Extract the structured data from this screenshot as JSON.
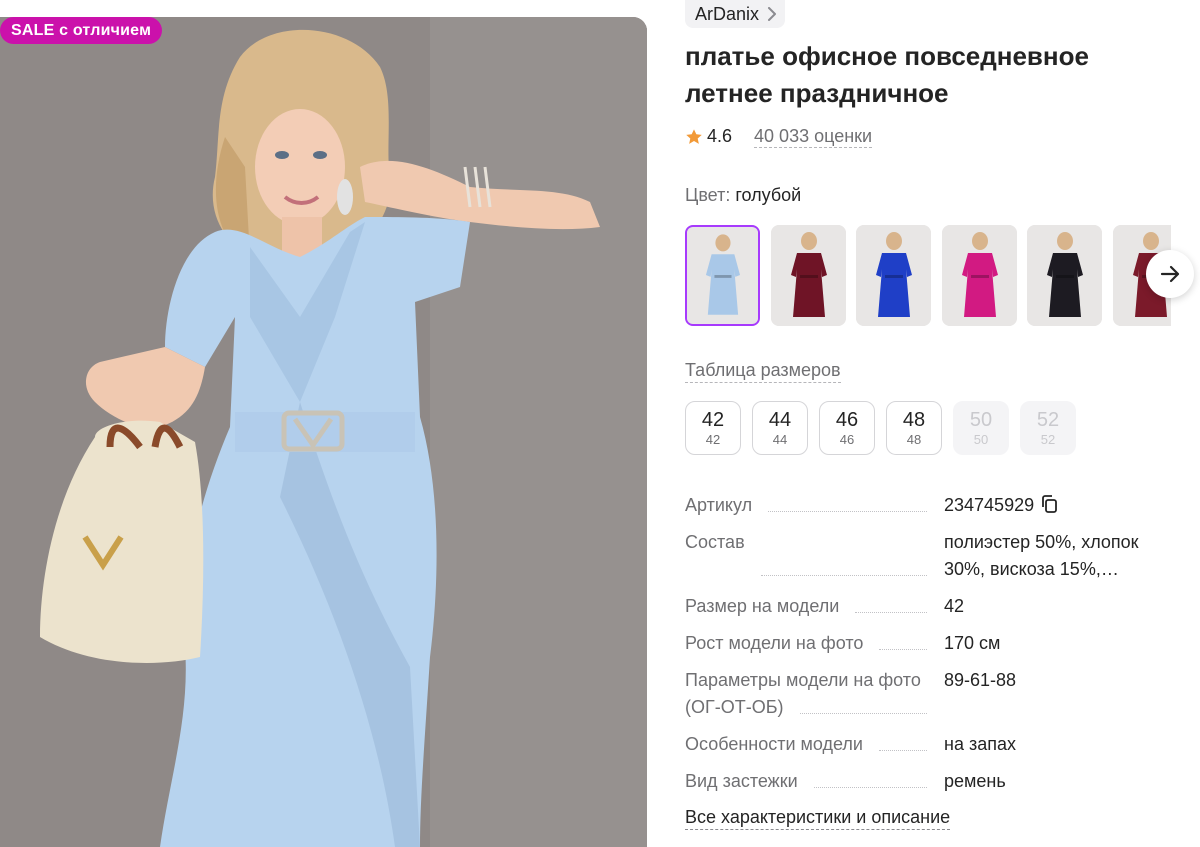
{
  "badge": {
    "sale_label": "SALE с отличием"
  },
  "product": {
    "brand": "ArDanix",
    "title": "платье офисное повседневное летнее праздничное",
    "rating": "4.6",
    "reviews": "40 033 оценки",
    "color_label": "Цвет:",
    "color_value": "голубой"
  },
  "swatches": [
    {
      "name": "light-blue",
      "color": "#a9c8e8",
      "selected": true
    },
    {
      "name": "burgundy",
      "color": "#6f1426"
    },
    {
      "name": "royal-blue",
      "color": "#1f3fc7"
    },
    {
      "name": "fuchsia",
      "color": "#d21a82"
    },
    {
      "name": "black-floral",
      "color": "#1d1b22"
    },
    {
      "name": "wine",
      "color": "#7b1a2a"
    }
  ],
  "size_table_label": "Таблица размеров",
  "sizes": [
    {
      "ru": "42",
      "intl": "42",
      "available": true
    },
    {
      "ru": "44",
      "intl": "44",
      "available": true
    },
    {
      "ru": "46",
      "intl": "46",
      "available": true
    },
    {
      "ru": "48",
      "intl": "48",
      "available": true
    },
    {
      "ru": "50",
      "intl": "50",
      "available": false
    },
    {
      "ru": "52",
      "intl": "52",
      "available": false
    }
  ],
  "specs": [
    {
      "key": "Артикул",
      "value": "234745929",
      "copy": true
    },
    {
      "key": "Состав",
      "value": "полиэстер 50%, хлопок 30%, вискоза 15%,…"
    },
    {
      "key": "Размер на модели",
      "value": "42"
    },
    {
      "key": "Рост модели на фото",
      "value": "170 см"
    },
    {
      "key": "Параметры модели на фото (ОГ-ОТ-ОБ)",
      "value": "89-61-88"
    },
    {
      "key": "Особенности модели",
      "value": "на запах"
    },
    {
      "key": "Вид застежки",
      "value": "ремень"
    }
  ],
  "all_specs_link": "Все характеристики и описание",
  "icons": {
    "brand_chevron": "chevron-right-icon",
    "rating": "star-icon",
    "next": "arrow-right-icon",
    "copy": "copy-icon"
  },
  "colors": {
    "accent": "#cb11ab",
    "selected_border": "#a73afd",
    "star": "#f29a38",
    "text": "#242424",
    "muted": "#6f6f72"
  }
}
